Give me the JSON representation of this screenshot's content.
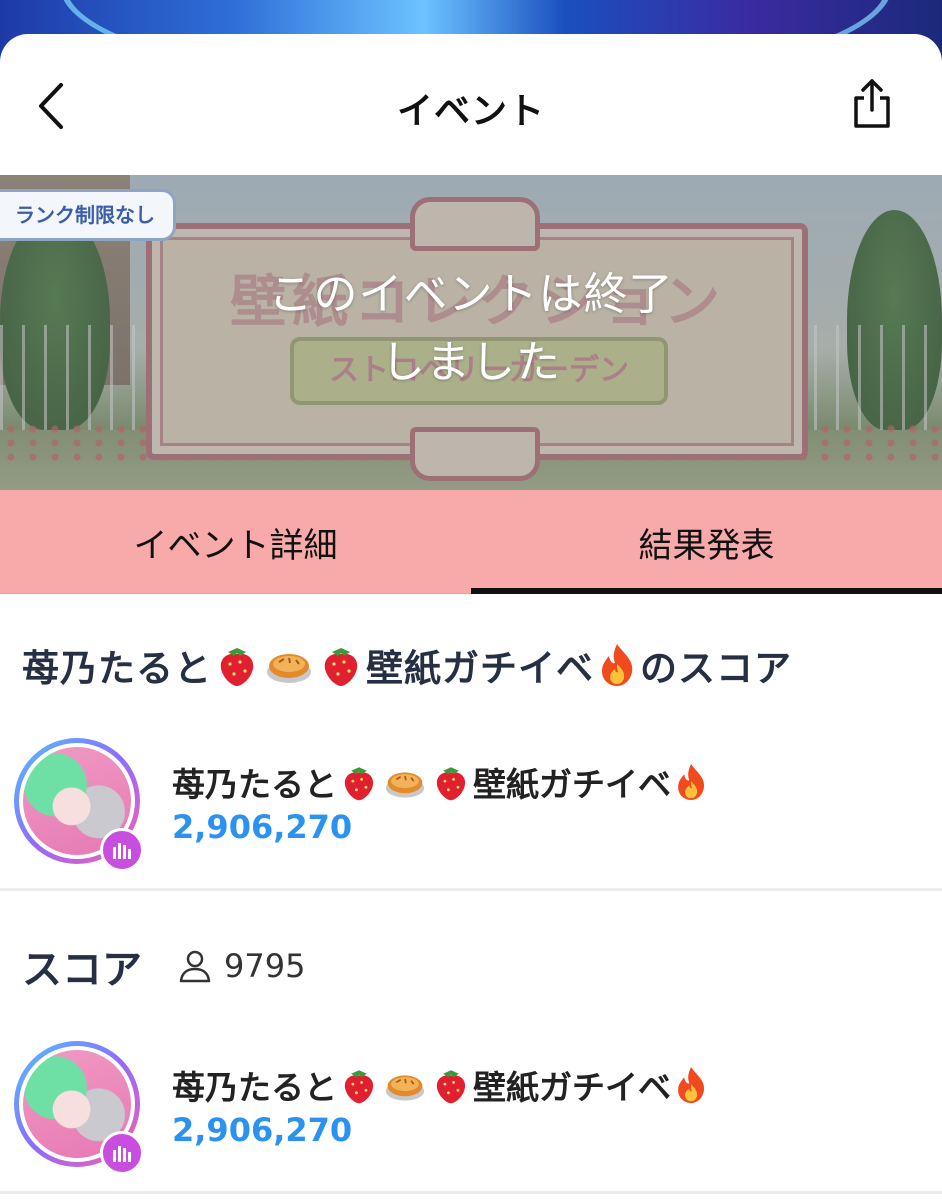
{
  "header": {
    "title": "イベント"
  },
  "banner": {
    "rank_tag": "ランク制限なし",
    "sign_title": "壁紙コレクション",
    "sign_ribbon": "ストロベリーガーデン",
    "ended_line1": "このイベントは終了",
    "ended_line2": "しました"
  },
  "tabs": [
    {
      "label": "イベント詳細",
      "active": false
    },
    {
      "label": "結果発表",
      "active": true
    }
  ],
  "user_score_section": {
    "title_prefix": "苺乃たると",
    "title_middle": "壁紙ガチイベ",
    "title_suffix": "のスコア",
    "entry": {
      "name_prefix": "苺乃たると",
      "name_suffix": "壁紙ガチイベ",
      "score": "2,906,270"
    }
  },
  "ranking_section": {
    "label": "スコア",
    "participants": "9795",
    "entries": [
      {
        "name_prefix": "苺乃たると",
        "name_suffix": "壁紙ガチイベ",
        "score": "2,906,270"
      }
    ]
  },
  "colors": {
    "tab_bg": "#f8a9a9",
    "score_blue": "#2b92f0",
    "title_dark": "#273043",
    "badge_purple": "#c84ee0"
  },
  "icons": [
    "back-chevron-icon",
    "share-icon",
    "strawberry-icon",
    "pie-icon",
    "fire-icon",
    "person-icon",
    "live-bars-icon"
  ]
}
